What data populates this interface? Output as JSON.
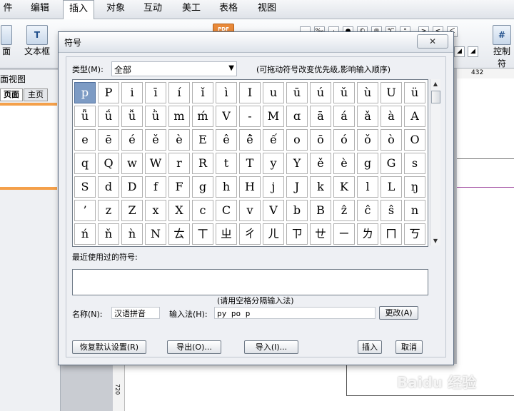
{
  "menubar": {
    "items": [
      "件",
      "编辑",
      "插入",
      "对象",
      "互动",
      "美工",
      "表格",
      "视图"
    ]
  },
  "ribbon": {
    "page_label": "面",
    "textbox_label": "文本框",
    "control_label": "控制符",
    "pdf_label": "PDF"
  },
  "left_panel": {
    "view_title": "面视图",
    "tab_page": "页面",
    "tab_master": "主页"
  },
  "ruler": {
    "right_mark": "432",
    "vertical_mark": "720"
  },
  "dialog": {
    "title": "符号",
    "close": "✕",
    "type_label": "类型(M):",
    "type_value": "全部",
    "hint": "(可拖动符号改变优先级,影响输入顺序)",
    "symbols": [
      [
        "p",
        "P",
        "i",
        "ī",
        "í",
        "ǐ",
        "ì",
        "I",
        "u",
        "ū",
        "ú",
        "ǔ",
        "ù",
        "U",
        "ü"
      ],
      [
        "ǖ",
        "ǘ",
        "ǚ",
        "ǜ",
        "m",
        "ḿ",
        "V",
        "-",
        "M",
        "ɑ",
        "ā",
        "á",
        "ǎ",
        "à",
        "A"
      ],
      [
        "e",
        "ē",
        "é",
        "ě",
        "è",
        "E",
        "ê",
        "ê̄",
        "ế",
        "o",
        "ō",
        "ó",
        "ǒ",
        "ò",
        "O"
      ],
      [
        "q",
        "Q",
        "w",
        "W",
        "r",
        "R",
        "t",
        "T",
        "y",
        "Y",
        "ě",
        "è",
        "g",
        "G",
        "s"
      ],
      [
        "S",
        "d",
        "D",
        "f",
        "F",
        "g",
        "h",
        "H",
        "j",
        "J",
        "k",
        "K",
        "l",
        "L",
        "ŋ"
      ],
      [
        "’",
        "z",
        "Z",
        "x",
        "X",
        "c",
        "C",
        "v",
        "V",
        "b",
        "B",
        "ẑ",
        "ĉ",
        "ŝ",
        "n"
      ],
      [
        "ń",
        "ň",
        "ǹ",
        "N",
        "ㄊ",
        "ㄒ",
        "ㄓ",
        "ㄔ",
        "ㄦ",
        "ㄗ",
        "ㄝ",
        "ㄧ",
        "ㄌ",
        "ㄇ",
        "ㄎ"
      ]
    ],
    "recent_label": "最近使用过的符号:",
    "space_hint": "(请用空格分隔输入法)",
    "name_label": "名称(N):",
    "name_value": "汉语拼音",
    "input_label": "输入法(H):",
    "input_value": "py po p",
    "change_button": "更改(A)",
    "restore_button": "恢复默认设置(R)",
    "export_button": "导出(O)...",
    "import_button": "导入(I)...",
    "insert_button": "插入",
    "cancel_button": "取消"
  },
  "watermark": "Baidu 经验"
}
